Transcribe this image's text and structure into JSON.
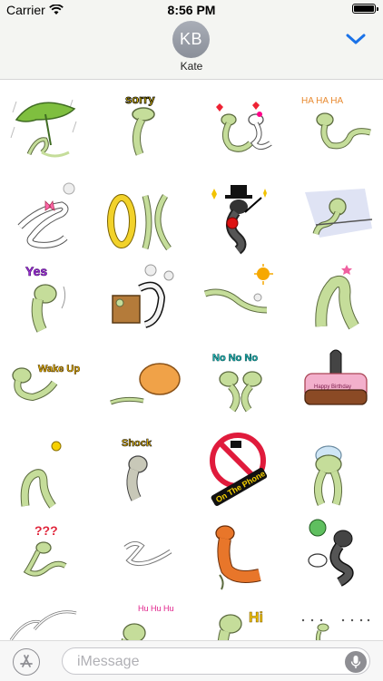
{
  "status_bar": {
    "carrier": "Carrier",
    "time": "8:56 PM"
  },
  "header": {
    "avatar_initials": "KB",
    "contact_name": "Kate",
    "collapse_icon": "chevron-down-icon"
  },
  "stickers": [
    {
      "id": "rain-leaf",
      "text": ""
    },
    {
      "id": "sorry",
      "text": "sorry"
    },
    {
      "id": "hearts-couple",
      "text": ""
    },
    {
      "id": "ha-ha-ha",
      "text": "HA HA HA"
    },
    {
      "id": "bow-sigh",
      "text": ""
    },
    {
      "id": "ok",
      "text": "OK"
    },
    {
      "id": "top-hat-rose",
      "text": ""
    },
    {
      "id": "sliding",
      "text": ""
    },
    {
      "id": "yes",
      "text": "Yes"
    },
    {
      "id": "box-fight",
      "text": ""
    },
    {
      "id": "sunny-sleep",
      "text": ""
    },
    {
      "id": "star-shy",
      "text": ""
    },
    {
      "id": "wake-up",
      "text": "Wake Up"
    },
    {
      "id": "egg",
      "text": ""
    },
    {
      "id": "no-no-no",
      "text": "No No No"
    },
    {
      "id": "birthday",
      "text": "Happy Birthday"
    },
    {
      "id": "idea",
      "text": ""
    },
    {
      "id": "shock",
      "text": "Shock"
    },
    {
      "id": "on-the-phone",
      "text": "On The Phone"
    },
    {
      "id": "brain",
      "text": ""
    },
    {
      "id": "question",
      "text": "???"
    },
    {
      "id": "sketch",
      "text": ""
    },
    {
      "id": "orange-snake",
      "text": ""
    },
    {
      "id": "frog-cobra",
      "text": ""
    },
    {
      "id": "squiggle",
      "text": ""
    },
    {
      "id": "hu-hu-hu",
      "text": "Hu Hu Hu"
    },
    {
      "id": "hi",
      "text": "Hi"
    },
    {
      "id": "dots",
      "text": ""
    }
  ],
  "bottom_bar": {
    "apps_icon": "app-store-icon",
    "message_placeholder": "iMessage",
    "mic_icon": "microphone-icon"
  },
  "colors": {
    "snake_green": "#c5dd9a",
    "snake_outline": "#5c6b3f",
    "accent_blue": "#1a72e8"
  }
}
